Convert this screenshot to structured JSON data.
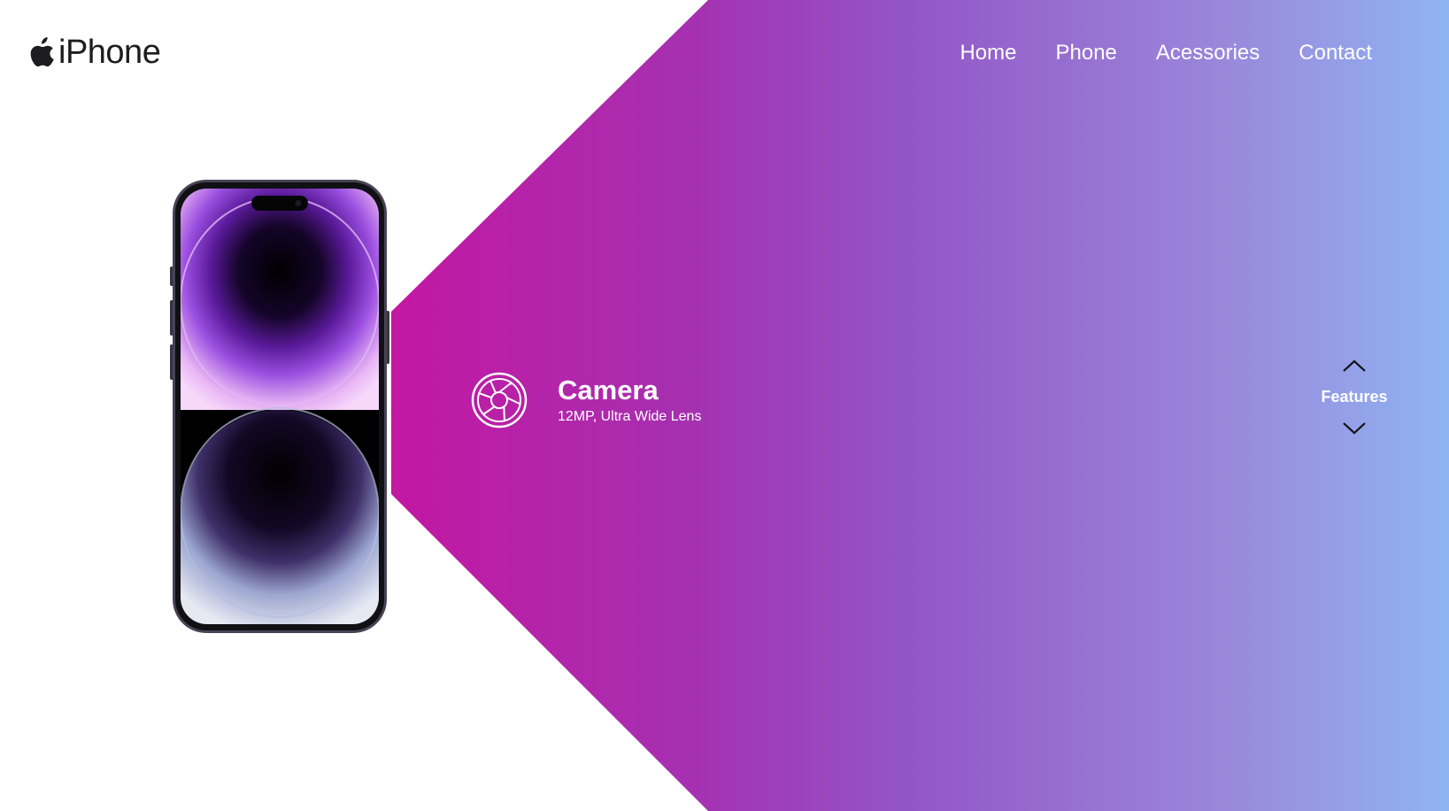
{
  "brand": {
    "name": "iPhone",
    "logo_icon": "apple-logo-icon"
  },
  "nav": {
    "items": [
      {
        "label": "Home"
      },
      {
        "label": "Phone"
      },
      {
        "label": "Acessories"
      },
      {
        "label": "Contact"
      }
    ]
  },
  "hero": {
    "image": "iphone-device-image"
  },
  "feature": {
    "icon": "camera-aperture-icon",
    "title": "Camera",
    "description": "12MP, Ultra Wide Lens"
  },
  "section_nav": {
    "label": "Features",
    "up_icon": "chevron-up-icon",
    "down_icon": "chevron-down-icon"
  },
  "colors": {
    "gradient_start": "#d0119a",
    "gradient_mid": "#9354c6",
    "gradient_end": "#8fb4f2",
    "brand_text": "#1d1d1f",
    "nav_text": "#ffffff"
  }
}
